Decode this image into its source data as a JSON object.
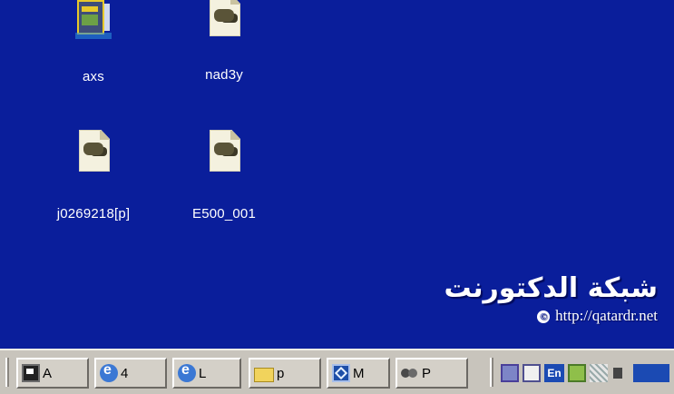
{
  "desktop": {
    "background_color": "#0a1e9b",
    "icons": [
      {
        "label": "axs",
        "icon": "application-icon"
      },
      {
        "label": "nad3y",
        "icon": "paint-document-icon"
      },
      {
        "label": "j0269218[p]",
        "icon": "image-document-icon"
      },
      {
        "label": "E500_001",
        "icon": "paint-document-icon"
      }
    ]
  },
  "watermark": {
    "arabic_text": "شبكة الدكتورنت",
    "url_text": "http://qatardr.net",
    "copyright_symbol": "©"
  },
  "taskbar": {
    "buttons": [
      {
        "label": "A",
        "icon": "display-icon"
      },
      {
        "label": "4",
        "icon": "internet-explorer-icon"
      },
      {
        "label": "L",
        "icon": "internet-explorer-icon"
      },
      {
        "label": "p",
        "icon": "folder-icon"
      },
      {
        "label": "M",
        "icon": "mail-icon"
      },
      {
        "label": "P",
        "icon": "paint-icon"
      }
    ],
    "tray": {
      "language": "En",
      "icons": [
        "network-icon",
        "desktop-icon",
        "language-icon",
        "help-icon",
        "scheduler-icon",
        "speaker-icon",
        "overflow-icon"
      ]
    }
  }
}
